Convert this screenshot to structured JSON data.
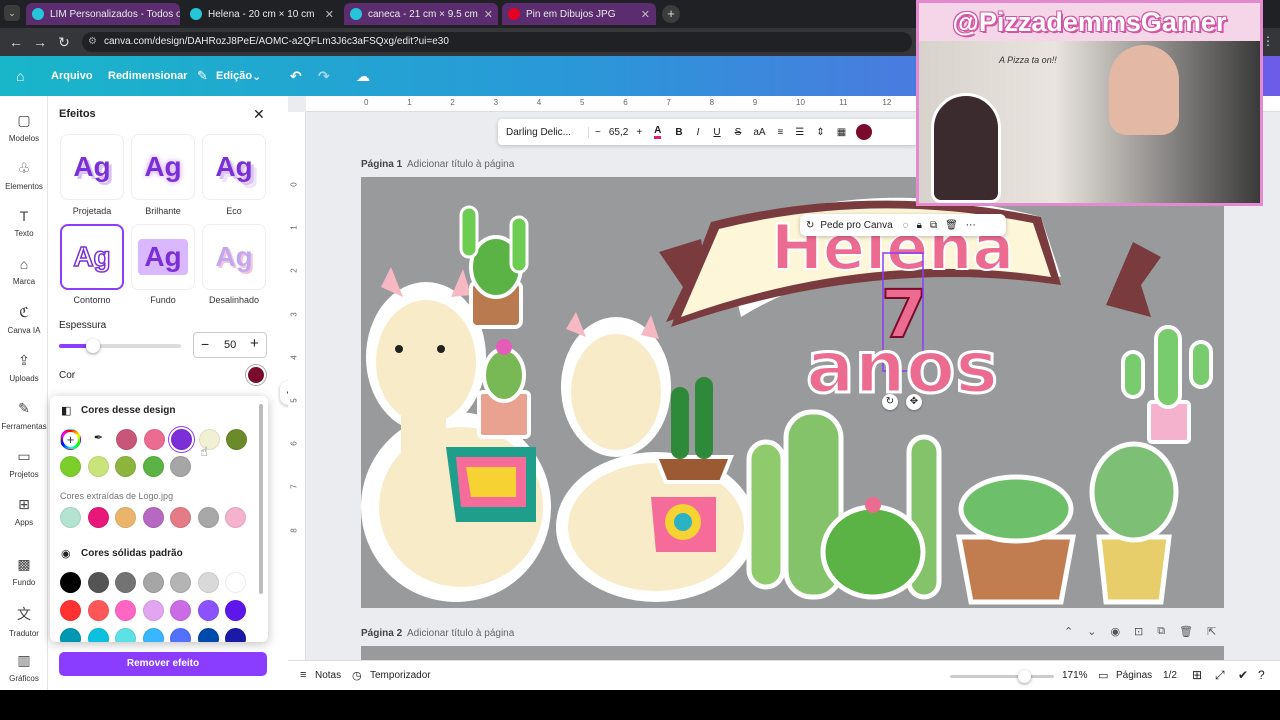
{
  "browser": {
    "tabs": [
      "LIM Personalizados - Todos os",
      "Helena - 20 cm × 10 cm",
      "caneca - 21 cm × 9.5 cm",
      "Pin em Dibujos JPG"
    ],
    "url": "canva.com/design/DAHRozJ8PeE/AOMC-a2QFLm3J6c3aFSQxg/edit?ui=e30"
  },
  "header": {
    "arquivo": "Arquivo",
    "redimensionar": "Redimensionar",
    "edicao": "Edição"
  },
  "rail": [
    "Modelos",
    "Elementos",
    "Texto",
    "Marca",
    "Canva IA",
    "Uploads",
    "Ferramentas",
    "Projetos",
    "Apps",
    "Fundo",
    "Tradutor",
    "Gráficos"
  ],
  "panel": {
    "title": "Efeitos",
    "effects": [
      "Projetada",
      "Brilhante",
      "Eco",
      "Contorno",
      "Fundo",
      "Desalinhado"
    ],
    "effect_glyph": "Ag",
    "espessura_label": "Espessura",
    "espessura_value": "50",
    "cor_label": "Cor",
    "remove_button": "Remover efeito"
  },
  "colors": {
    "design_title": "Cores desse design",
    "logo_title": "Cores extraídas de Logo.jpg",
    "solid_title": "Cores sólidas padrão",
    "design": [
      "#c8567a",
      "#ec6b91",
      "#7b2fd6",
      "#f2f0d2",
      "#6b8a2a",
      "#7ccf2b",
      "#c9e47a",
      "#8db43d",
      "#5bb245",
      "#a6a6a6"
    ],
    "logo": [
      "#b4e3d2",
      "#e8177a",
      "#eab56b",
      "#b669c0",
      "#e37c86",
      "#a8a8a8",
      "#f5b2cd"
    ],
    "solid": [
      "#000000",
      "#545454",
      "#737373",
      "#a6a6a6",
      "#b4b4b4",
      "#d9d9d9",
      "#ffffff",
      "#ff3131",
      "#ff5757",
      "#ff66c4",
      "#e2a5f0",
      "#cb6ce6",
      "#8c52ff",
      "#5e17eb",
      "#0097b2",
      "#0cc0df",
      "#5ce1e6",
      "#38b6ff",
      "#5271ff",
      "#004aad",
      "#1b1aa6"
    ],
    "selected": "#7a0b2c"
  },
  "texttoolbar": {
    "font": "Darling Delic...",
    "size": "65,2"
  },
  "canvas": {
    "page1_label": "Página 1",
    "page1_add": "Adicionar título à página",
    "page2_label": "Página 2",
    "page2_add": "Adicionar título à página",
    "banner_text": "Helena",
    "age": "7",
    "anos": "anos",
    "ai_button": "Pede pro Canva",
    "ruler": [
      "0",
      "1",
      "2",
      "3",
      "4",
      "5",
      "6",
      "7",
      "8",
      "9",
      "10",
      "11",
      "12"
    ],
    "vruler": [
      "0",
      "1",
      "2",
      "3",
      "4",
      "5",
      "6",
      "7",
      "8"
    ]
  },
  "footer": {
    "notas": "Notas",
    "timer": "Temporizador",
    "zoom": "171%",
    "pages_label": "Páginas",
    "pages": "1/2"
  },
  "stream": {
    "channel": "@PizzademmsGamer",
    "sign": "A Pizza ta on!!"
  }
}
